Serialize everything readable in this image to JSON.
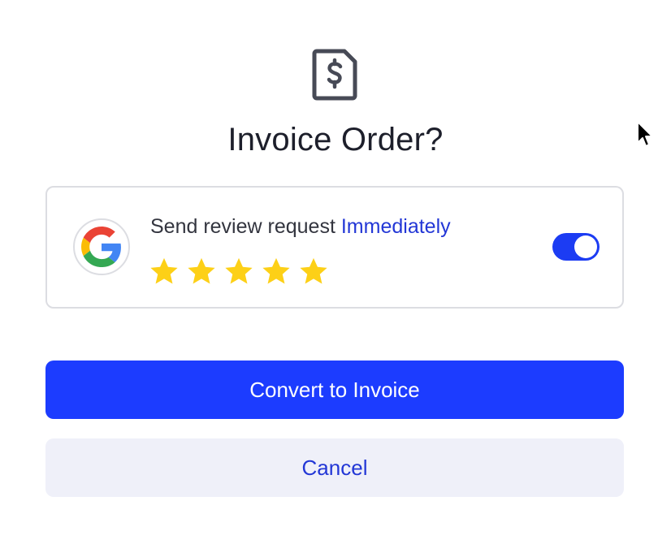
{
  "dialog": {
    "title": "Invoice Order?",
    "icon": "invoice-dollar-icon"
  },
  "review": {
    "prefix": "Send review request ",
    "timing": "Immediately",
    "provider_icon": "google-logo-icon",
    "rating": 5,
    "rating_max": 5,
    "toggle_on": true
  },
  "actions": {
    "primary_label": "Convert to Invoice",
    "secondary_label": "Cancel"
  },
  "colors": {
    "accent": "#1c3cff",
    "link": "#2337d6",
    "star": "#fdd017",
    "secondary_bg": "#eff0f9",
    "title": "#1d1f2b"
  }
}
